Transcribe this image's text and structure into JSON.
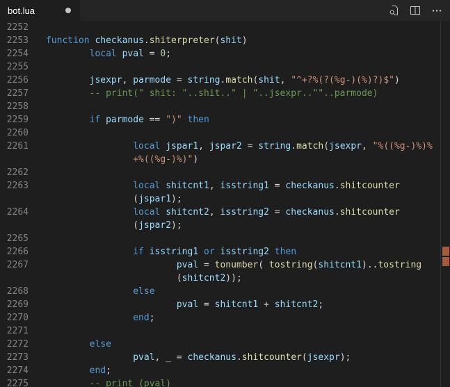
{
  "tab": {
    "filename": "bot.lua",
    "modified": true
  },
  "colors": {
    "background": "#1e1e1e",
    "tabbar_background": "#252526",
    "tab_text": "#ffffff",
    "modified_dot": "#c4c4c4",
    "line_number": "#858585",
    "icon": "#c5c5c5",
    "overview_marker": "#a85a3c"
  },
  "editor_actions": {
    "icons": [
      "open-changes-icon",
      "split-editor-icon",
      "more-actions-icon"
    ]
  },
  "editor": {
    "language": "lua",
    "palette": {
      "kw": "#569cd6",
      "vr": "#9cdcfe",
      "fn": "#dcdcaa",
      "st": "#ce9178",
      "cm": "#6a9955",
      "nm": "#b5cea8",
      "pl": "#d4d4d4"
    },
    "rows": [
      {
        "n": "2252",
        "s": []
      },
      {
        "n": "2253",
        "s": [
          [
            "kw",
            "function"
          ],
          [
            "pl",
            " "
          ],
          [
            "vr",
            "checkanus"
          ],
          [
            "pl",
            "."
          ],
          [
            "fn",
            "shiterpreter"
          ],
          [
            "pl",
            "("
          ],
          [
            "vr",
            "shit"
          ],
          [
            "pl",
            ")"
          ]
        ]
      },
      {
        "n": "2254",
        "s": [
          [
            "pl",
            "        "
          ],
          [
            "kw",
            "local"
          ],
          [
            "pl",
            " "
          ],
          [
            "vr",
            "pval"
          ],
          [
            "pl",
            " = "
          ],
          [
            "nm",
            "0"
          ],
          [
            "pl",
            ";"
          ]
        ]
      },
      {
        "n": "2255",
        "s": []
      },
      {
        "n": "2256",
        "s": [
          [
            "pl",
            "        "
          ],
          [
            "vr",
            "jsexpr"
          ],
          [
            "pl",
            ", "
          ],
          [
            "vr",
            "parmode"
          ],
          [
            "pl",
            " = "
          ],
          [
            "vr",
            "string"
          ],
          [
            "pl",
            "."
          ],
          [
            "fn",
            "match"
          ],
          [
            "pl",
            "("
          ],
          [
            "vr",
            "shit"
          ],
          [
            "pl",
            ", "
          ],
          [
            "st",
            "\"^+?%(?(%g-)(%)?)$\""
          ],
          [
            "pl",
            ")"
          ]
        ]
      },
      {
        "n": "2257",
        "s": [
          [
            "pl",
            "        "
          ],
          [
            "cm",
            "-- print(\" shit: \"..shit..\" | \"..jsexpr..\"\"..parmode)"
          ]
        ]
      },
      {
        "n": "2258",
        "s": []
      },
      {
        "n": "2259",
        "s": [
          [
            "pl",
            "        "
          ],
          [
            "kw",
            "if"
          ],
          [
            "pl",
            " "
          ],
          [
            "vr",
            "parmode"
          ],
          [
            "pl",
            " == "
          ],
          [
            "st",
            "\")\""
          ],
          [
            "pl",
            " "
          ],
          [
            "kw",
            "then"
          ]
        ]
      },
      {
        "n": "2260",
        "s": []
      },
      {
        "n": "2261",
        "s": [
          [
            "pl",
            "                "
          ],
          [
            "kw",
            "local"
          ],
          [
            "pl",
            " "
          ],
          [
            "vr",
            "jspar1"
          ],
          [
            "pl",
            ", "
          ],
          [
            "vr",
            "jspar2"
          ],
          [
            "pl",
            " = "
          ],
          [
            "vr",
            "string"
          ],
          [
            "pl",
            "."
          ],
          [
            "fn",
            "match"
          ],
          [
            "pl",
            "("
          ],
          [
            "vr",
            "jsexpr"
          ],
          [
            "pl",
            ", "
          ],
          [
            "st",
            "\"%((%g-)%)%"
          ]
        ]
      },
      {
        "n": "",
        "s": [
          [
            "pl",
            "                "
          ],
          [
            "st",
            "+%((%g-)%)\""
          ],
          [
            "pl",
            ")"
          ]
        ]
      },
      {
        "n": "2262",
        "s": []
      },
      {
        "n": "2263",
        "s": [
          [
            "pl",
            "                "
          ],
          [
            "kw",
            "local"
          ],
          [
            "pl",
            " "
          ],
          [
            "vr",
            "shitcnt1"
          ],
          [
            "pl",
            ", "
          ],
          [
            "vr",
            "isstring1"
          ],
          [
            "pl",
            " = "
          ],
          [
            "vr",
            "checkanus"
          ],
          [
            "pl",
            "."
          ],
          [
            "fn",
            "shitcounter"
          ]
        ]
      },
      {
        "n": "",
        "s": [
          [
            "pl",
            "                ("
          ],
          [
            "vr",
            "jspar1"
          ],
          [
            "pl",
            ");"
          ]
        ]
      },
      {
        "n": "2264",
        "s": [
          [
            "pl",
            "                "
          ],
          [
            "kw",
            "local"
          ],
          [
            "pl",
            " "
          ],
          [
            "vr",
            "shitcnt2"
          ],
          [
            "pl",
            ", "
          ],
          [
            "vr",
            "isstring2"
          ],
          [
            "pl",
            " = "
          ],
          [
            "vr",
            "checkanus"
          ],
          [
            "pl",
            "."
          ],
          [
            "fn",
            "shitcounter"
          ]
        ]
      },
      {
        "n": "",
        "s": [
          [
            "pl",
            "                ("
          ],
          [
            "vr",
            "jspar2"
          ],
          [
            "pl",
            ");"
          ]
        ]
      },
      {
        "n": "2265",
        "s": []
      },
      {
        "n": "2266",
        "s": [
          [
            "pl",
            "                "
          ],
          [
            "kw",
            "if"
          ],
          [
            "pl",
            " "
          ],
          [
            "vr",
            "isstring1"
          ],
          [
            "pl",
            " "
          ],
          [
            "kw",
            "or"
          ],
          [
            "pl",
            " "
          ],
          [
            "vr",
            "isstring2"
          ],
          [
            "pl",
            " "
          ],
          [
            "kw",
            "then"
          ]
        ]
      },
      {
        "n": "2267",
        "s": [
          [
            "pl",
            "                        "
          ],
          [
            "vr",
            "pval"
          ],
          [
            "pl",
            " = "
          ],
          [
            "fn",
            "tonumber"
          ],
          [
            "pl",
            "( "
          ],
          [
            "fn",
            "tostring"
          ],
          [
            "pl",
            "("
          ],
          [
            "vr",
            "shitcnt1"
          ],
          [
            "pl",
            ").."
          ],
          [
            "fn",
            "tostring"
          ]
        ]
      },
      {
        "n": "",
        "s": [
          [
            "pl",
            "                        ("
          ],
          [
            "vr",
            "shitcnt2"
          ],
          [
            "pl",
            "));"
          ]
        ]
      },
      {
        "n": "2268",
        "s": [
          [
            "pl",
            "                "
          ],
          [
            "kw",
            "else"
          ]
        ]
      },
      {
        "n": "2269",
        "s": [
          [
            "pl",
            "                        "
          ],
          [
            "vr",
            "pval"
          ],
          [
            "pl",
            " = "
          ],
          [
            "vr",
            "shitcnt1"
          ],
          [
            "pl",
            " + "
          ],
          [
            "vr",
            "shitcnt2"
          ],
          [
            "pl",
            ";"
          ]
        ]
      },
      {
        "n": "2270",
        "s": [
          [
            "pl",
            "                "
          ],
          [
            "kw",
            "end"
          ],
          [
            "pl",
            ";"
          ]
        ]
      },
      {
        "n": "2271",
        "s": []
      },
      {
        "n": "2272",
        "s": [
          [
            "pl",
            "        "
          ],
          [
            "kw",
            "else"
          ]
        ]
      },
      {
        "n": "2273",
        "s": [
          [
            "pl",
            "                "
          ],
          [
            "vr",
            "pval"
          ],
          [
            "pl",
            ", "
          ],
          [
            "vr",
            "_"
          ],
          [
            "pl",
            " = "
          ],
          [
            "vr",
            "checkanus"
          ],
          [
            "pl",
            "."
          ],
          [
            "fn",
            "shitcounter"
          ],
          [
            "pl",
            "("
          ],
          [
            "vr",
            "jsexpr"
          ],
          [
            "pl",
            ");"
          ]
        ]
      },
      {
        "n": "2274",
        "s": [
          [
            "pl",
            "        "
          ],
          [
            "kw",
            "end"
          ],
          [
            "pl",
            ";"
          ]
        ]
      },
      {
        "n": "2275",
        "s": [
          [
            "pl",
            "        "
          ],
          [
            "cm",
            "-- print (pval)"
          ]
        ]
      }
    ]
  }
}
